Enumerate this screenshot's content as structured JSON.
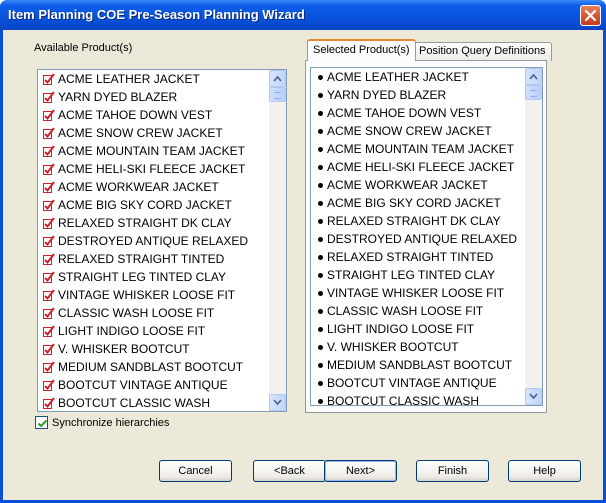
{
  "window": {
    "title": "Item Planning COE Pre-Season Planning Wizard"
  },
  "available": {
    "label": "Available Product(s)",
    "items": [
      "ACME LEATHER JACKET",
      "YARN DYED BLAZER",
      "ACME TAHOE DOWN VEST",
      "ACME SNOW CREW JACKET",
      "ACME MOUNTAIN TEAM JACKET",
      "ACME HELI-SKI FLEECE JACKET",
      "ACME WORKWEAR JACKET",
      "ACME BIG SKY CORD JACKET",
      "RELAXED STRAIGHT DK CLAY",
      "DESTROYED ANTIQUE RELAXED",
      "RELAXED STRAIGHT TINTED",
      "STRAIGHT LEG TINTED CLAY",
      "VINTAGE WHISKER LOOSE FIT",
      "CLASSIC WASH LOOSE FIT",
      "LIGHT INDIGO LOOSE FIT",
      "V. WHISKER BOOTCUT",
      "MEDIUM SANDBLAST BOOTCUT",
      "BOOTCUT VINTAGE ANTIQUE",
      "BOOTCUT CLASSIC WASH"
    ]
  },
  "tabs": {
    "selected_label": "Selected Product(s)",
    "other_label": "Position Query Definitions"
  },
  "selected": {
    "items": [
      "ACME LEATHER JACKET",
      "YARN DYED BLAZER",
      "ACME TAHOE DOWN VEST",
      "ACME SNOW CREW JACKET",
      "ACME MOUNTAIN TEAM JACKET",
      "ACME HELI-SKI FLEECE JACKET",
      "ACME WORKWEAR JACKET",
      "ACME BIG SKY CORD JACKET",
      "RELAXED STRAIGHT DK CLAY",
      "DESTROYED ANTIQUE RELAXED",
      "RELAXED STRAIGHT TINTED",
      "STRAIGHT LEG TINTED CLAY",
      "VINTAGE WHISKER LOOSE FIT",
      "CLASSIC WASH LOOSE FIT",
      "LIGHT INDIGO LOOSE FIT",
      "V. WHISKER BOOTCUT",
      "MEDIUM SANDBLAST BOOTCUT",
      "BOOTCUT VINTAGE ANTIQUE",
      "BOOTCUT CLASSIC WASH"
    ]
  },
  "sync": {
    "label": "Synchronize hierarchies",
    "checked": true
  },
  "buttons": {
    "cancel": "Cancel",
    "back": "<Back",
    "next": "Next>",
    "finish": "Finish",
    "help": "Help"
  },
  "icons": {
    "item_check": "checkmark-edit-icon",
    "item_bullet": "bullet-icon",
    "close": "close-icon"
  },
  "colors": {
    "titlebar": "#0a55de",
    "dialog_bg": "#ece9d8",
    "check_red": "#d0202a",
    "tab_accent": "#e68b2c"
  }
}
